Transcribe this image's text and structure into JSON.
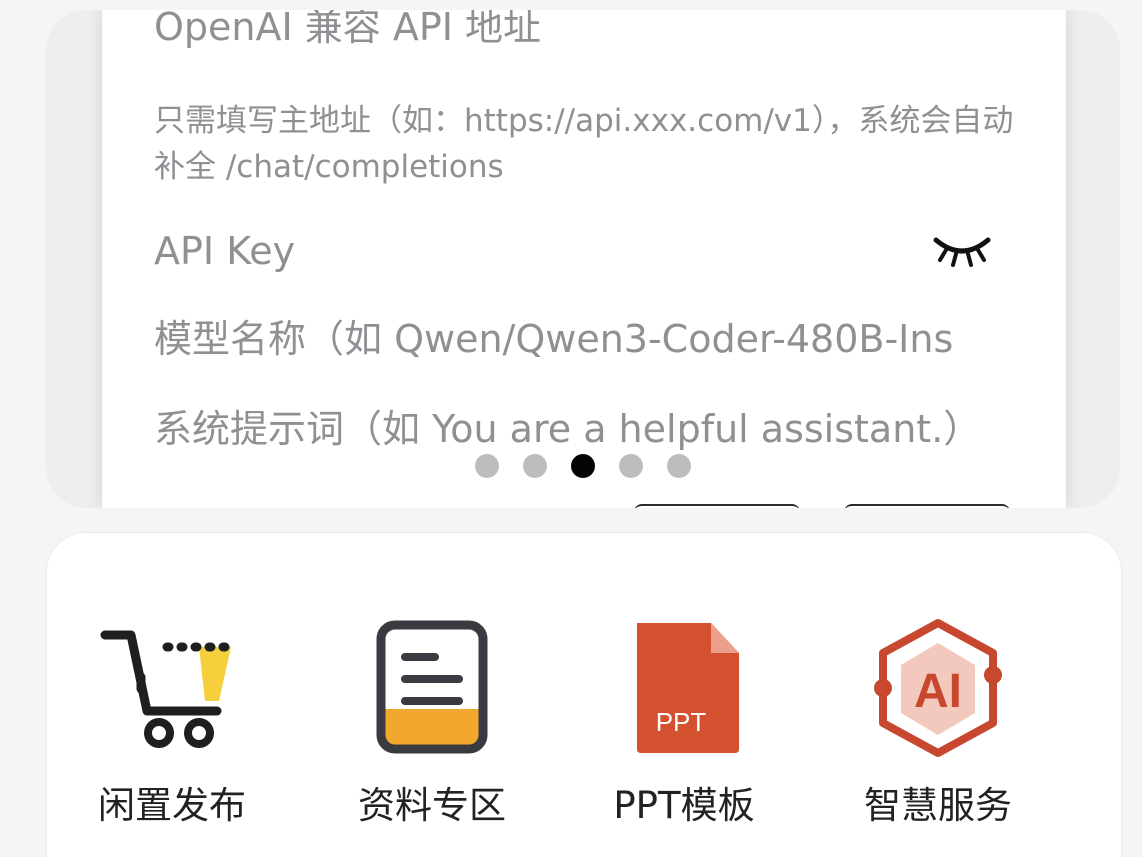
{
  "banner": {
    "slide": {
      "url_label": "OpenAI 兼容 API 地址",
      "url_hint": "只需填写主地址（如：https://api.xxx.com/v1），系统会自动补全 /chat/completions",
      "key_label": "API Key",
      "model_placeholder": "模型名称（如 Qwen/Qwen3-Coder-480B-Ins",
      "prompt_placeholder": "系统提示词（如 You are a helpful assistant.）"
    },
    "dots": {
      "count": 5,
      "active_index": 2
    }
  },
  "entries": [
    {
      "label": "闲置发布",
      "icon": "shopping-cart-icon"
    },
    {
      "label": "资料专区",
      "icon": "document-icon"
    },
    {
      "label": "PPT模板",
      "icon": "ppt-file-icon",
      "icon_text": "PPT"
    },
    {
      "label": "智慧服务",
      "icon": "ai-service-icon",
      "icon_text": "AI"
    }
  ],
  "colors": {
    "ppt_orange": "#d4512f",
    "ai_red": "#c7482f",
    "doc_yellow": "#f2a72f",
    "cart_yellow": "#f5cf3c"
  }
}
